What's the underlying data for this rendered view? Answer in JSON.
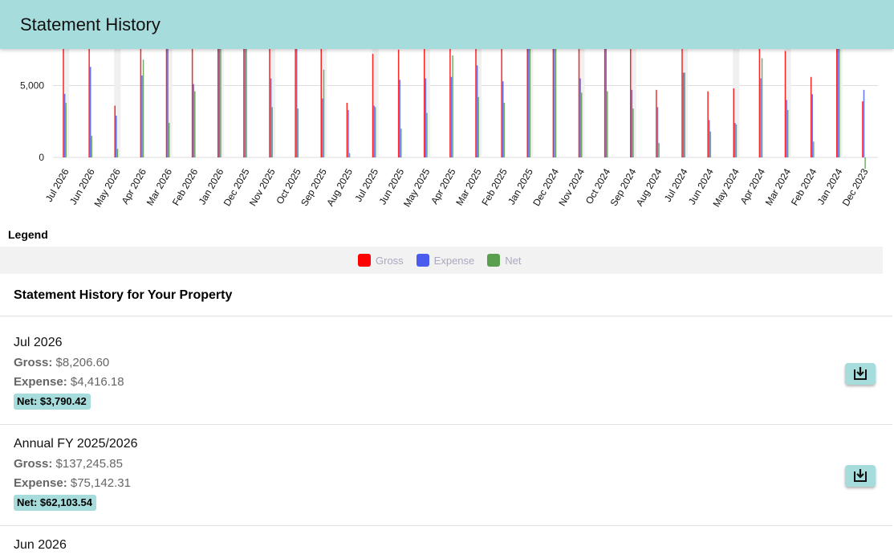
{
  "header": {
    "title": "Statement History"
  },
  "chart_data": {
    "type": "bar",
    "categories": [
      "Jul 2026",
      "Jun 2026",
      "May 2026",
      "Apr 2026",
      "Mar 2026",
      "Feb 2026",
      "Jan 2026",
      "Dec 2025",
      "Nov 2025",
      "Oct 2025",
      "Sep 2025",
      "Aug 2025",
      "Jul 2025",
      "Jun 2025",
      "May 2025",
      "Apr 2025",
      "Mar 2025",
      "Feb 2025",
      "Jan 2025",
      "Dec 2024",
      "Nov 2024",
      "Oct 2024",
      "Sep 2024",
      "Aug 2024",
      "Jul 2024",
      "Jun 2024",
      "May 2024",
      "Apr 2024",
      "Mar 2024",
      "Feb 2024",
      "Jan 2024",
      "Dec 2023"
    ],
    "series": [
      {
        "name": "Gross",
        "color": "#ff0000",
        "values": [
          8206.6,
          8200,
          3600,
          8200,
          8200,
          8200,
          8200,
          8200,
          8200,
          8200,
          8200,
          3800,
          7200,
          7500,
          8200,
          8200,
          8200,
          8200,
          8200,
          8200,
          8200,
          8200,
          8200,
          4700,
          8200,
          4600,
          4800,
          8200,
          7400,
          5600,
          8200,
          3900
        ]
      },
      {
        "name": "Expense",
        "color": "#4a5cf0",
        "values": [
          4416.18,
          6300,
          2900,
          5700,
          8200,
          5100,
          8200,
          8200,
          5500,
          8200,
          4100,
          3300,
          3600,
          5400,
          5500,
          5600,
          6400,
          5300,
          8200,
          8200,
          5500,
          8200,
          4700,
          3500,
          5900,
          2600,
          2400,
          5500,
          4000,
          4400,
          8200,
          4700
        ]
      },
      {
        "name": "Net",
        "color": "#5a9e4f",
        "values": [
          3790.42,
          1500,
          600,
          6800,
          2400,
          4600,
          8200,
          8200,
          3500,
          3400,
          6100,
          300,
          3500,
          2000,
          3100,
          7100,
          4200,
          3800,
          8200,
          8200,
          4500,
          4600,
          3400,
          1000,
          5900,
          1800,
          2300,
          6900,
          3300,
          1100,
          8200,
          -800
        ]
      }
    ],
    "yticks": [
      0,
      5000
    ],
    "ytick_labels": [
      "0",
      "5,000"
    ],
    "ylim": [
      -1000,
      8200
    ],
    "grid": true,
    "legend_title": "Legend"
  },
  "legend": {
    "items": [
      {
        "label": "Gross",
        "color": "#ff0000"
      },
      {
        "label": "Expense",
        "color": "#4a5cf0"
      },
      {
        "label": "Net",
        "color": "#5a9e4f"
      }
    ]
  },
  "section": {
    "title": "Statement History for Your Property"
  },
  "statements": [
    {
      "title": "Jul 2026",
      "gross_label": "Gross:",
      "gross": "$8,206.60",
      "expense_label": "Expense:",
      "expense": "$4,416.18",
      "net": "Net: $3,790.42",
      "icon": "download-icon"
    },
    {
      "title": "Annual FY 2025/2026",
      "gross_label": "Gross:",
      "gross": "$137,245.85",
      "expense_label": "Expense:",
      "expense": "$75,142.31",
      "net": "Net: $62,103.54",
      "icon": "download-icon"
    },
    {
      "title": "Jun 2026"
    }
  ]
}
